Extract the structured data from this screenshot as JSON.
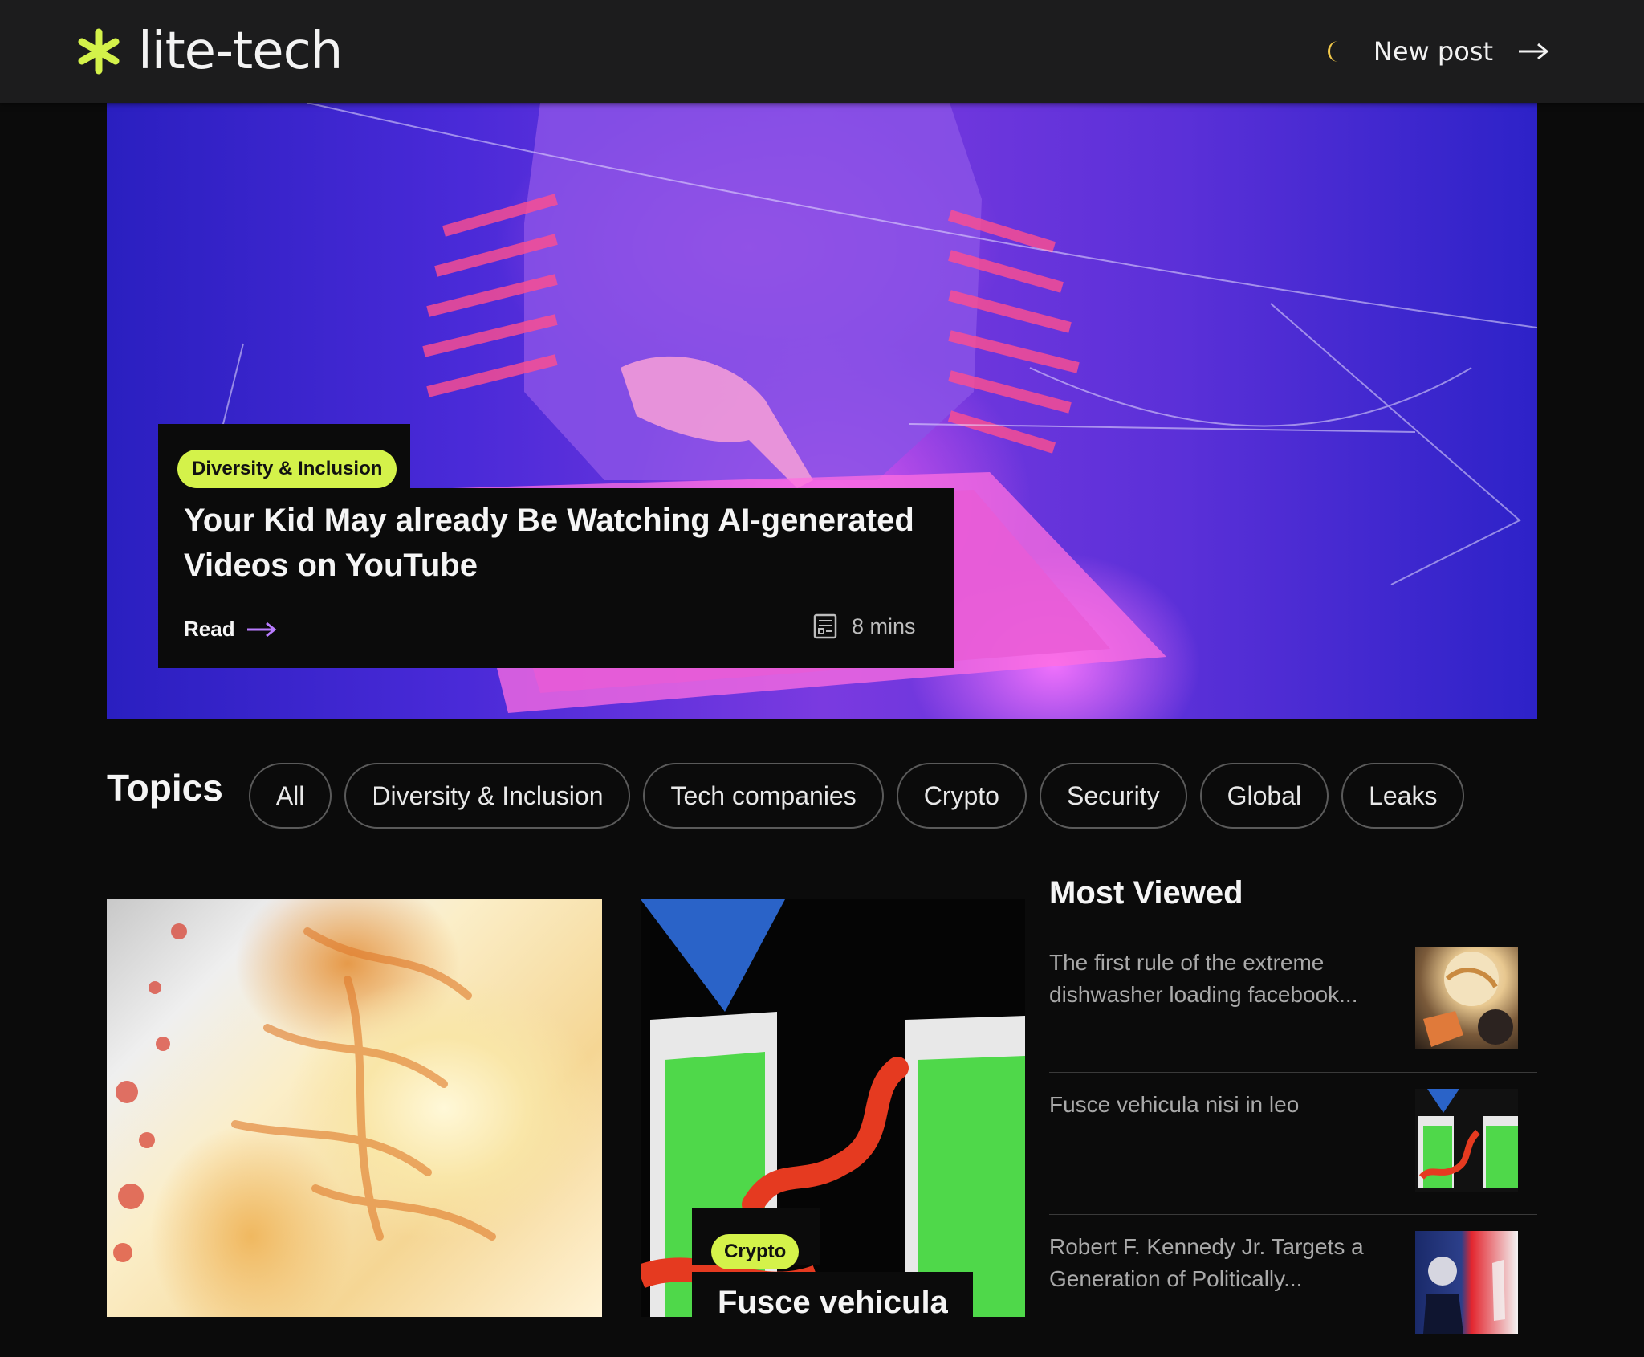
{
  "header": {
    "brand": "lite-tech",
    "new_post_label": "New post"
  },
  "colors": {
    "accent_lime": "#d4f24a",
    "accent_purple": "#b97cff",
    "background": "#0b0b0b",
    "header_bg": "#1c1c1d"
  },
  "icons": [
    "asterisk-logo-icon",
    "moon-icon",
    "arrow-right-icon",
    "document-icon"
  ],
  "hero": {
    "tag": "Diversity & Inclusion",
    "title": "Your Kid May already Be Watching AI-generated Videos on YouTube",
    "read_label": "Read",
    "read_time": "8 mins"
  },
  "topics": {
    "title": "Topics",
    "chips": [
      "All",
      "Diversity & Inclusion",
      "Tech companies",
      "Crypto",
      "Security",
      "Global",
      "Leaks"
    ]
  },
  "cards": [
    {
      "tag": "",
      "title": ""
    },
    {
      "tag": "Crypto",
      "title": "Fusce vehicula"
    }
  ],
  "most_viewed": {
    "title": "Most Viewed",
    "items": [
      {
        "text": "The first rule of the extreme dishwasher loading facebook..."
      },
      {
        "text": "Fusce vehicula nisi in leo"
      },
      {
        "text": "Robert F. Kennedy Jr. Targets a Generation of Politically..."
      }
    ]
  }
}
